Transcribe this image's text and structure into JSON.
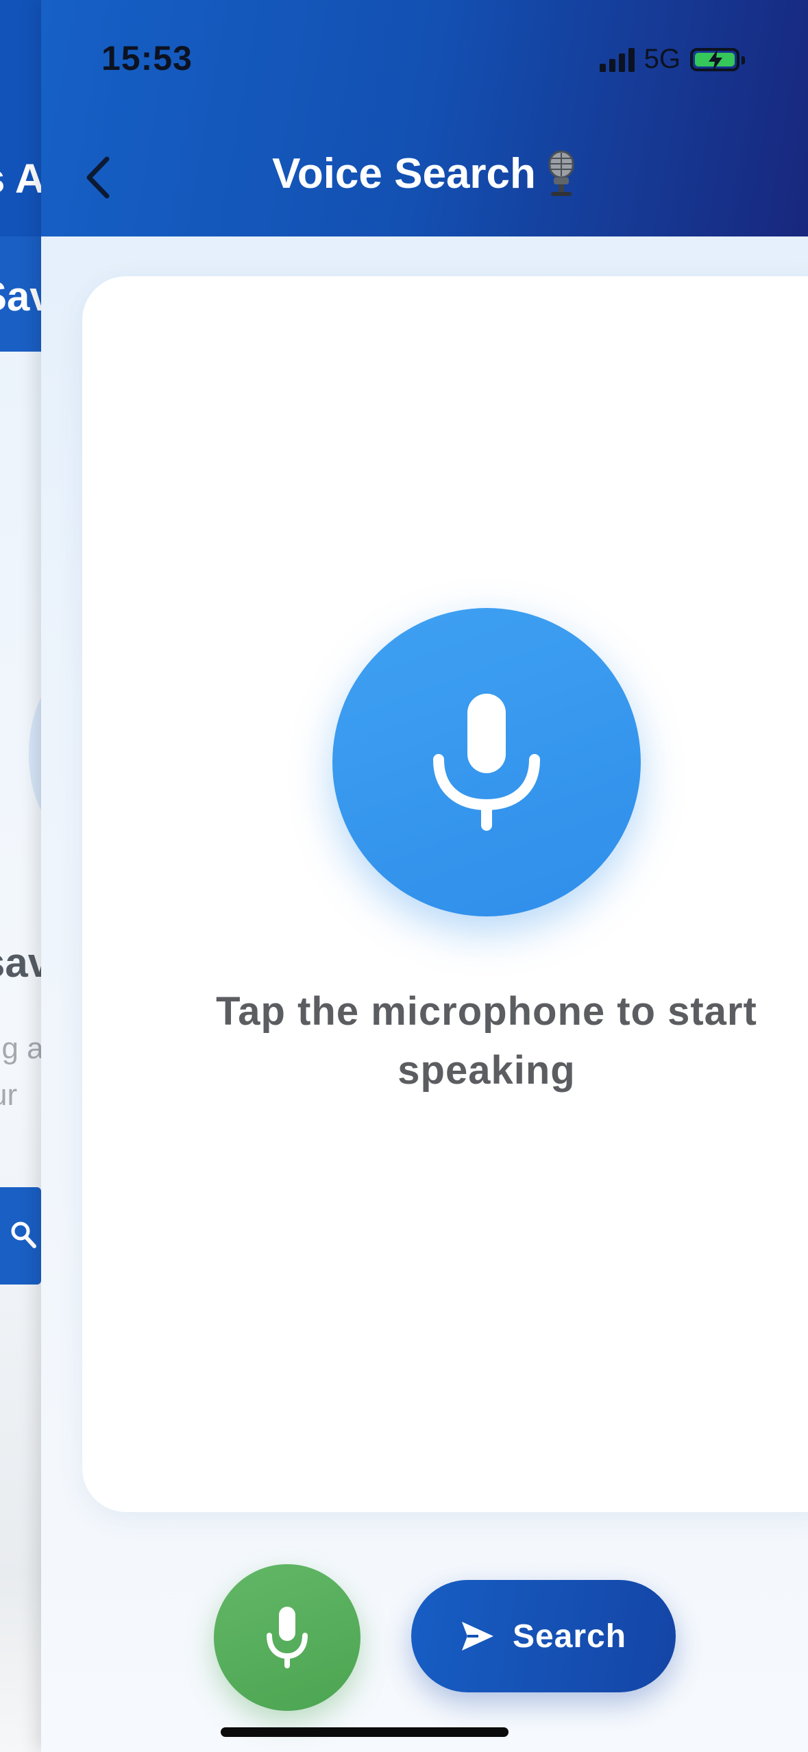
{
  "status_bar": {
    "time": "15:53",
    "network": "5G",
    "battery_color": "#35c759"
  },
  "background_page": {
    "header_fragment": "s A",
    "tab_fragment": "Sav",
    "title_fragment": "sav",
    "subtitle_line1_fragment": "ng a",
    "subtitle_line2_fragment": "ur",
    "button_icon": "search-icon"
  },
  "header": {
    "title": "Voice Search",
    "title_icon": "studio-microphone-emoji",
    "back_icon": "chevron-left-icon",
    "gradient_start": "#1660c6",
    "gradient_end": "#18277d"
  },
  "card": {
    "mic_icon": "microphone-icon",
    "mic_color": "#3b9af0",
    "hint_line1": "Tap the microphone to start",
    "hint_line2": "speaking"
  },
  "actions": {
    "mic_button_icon": "microphone-icon",
    "mic_button_color": "#56ad5b",
    "search_icon": "send-icon",
    "search_label": "Search",
    "search_color": "#1553b6"
  }
}
